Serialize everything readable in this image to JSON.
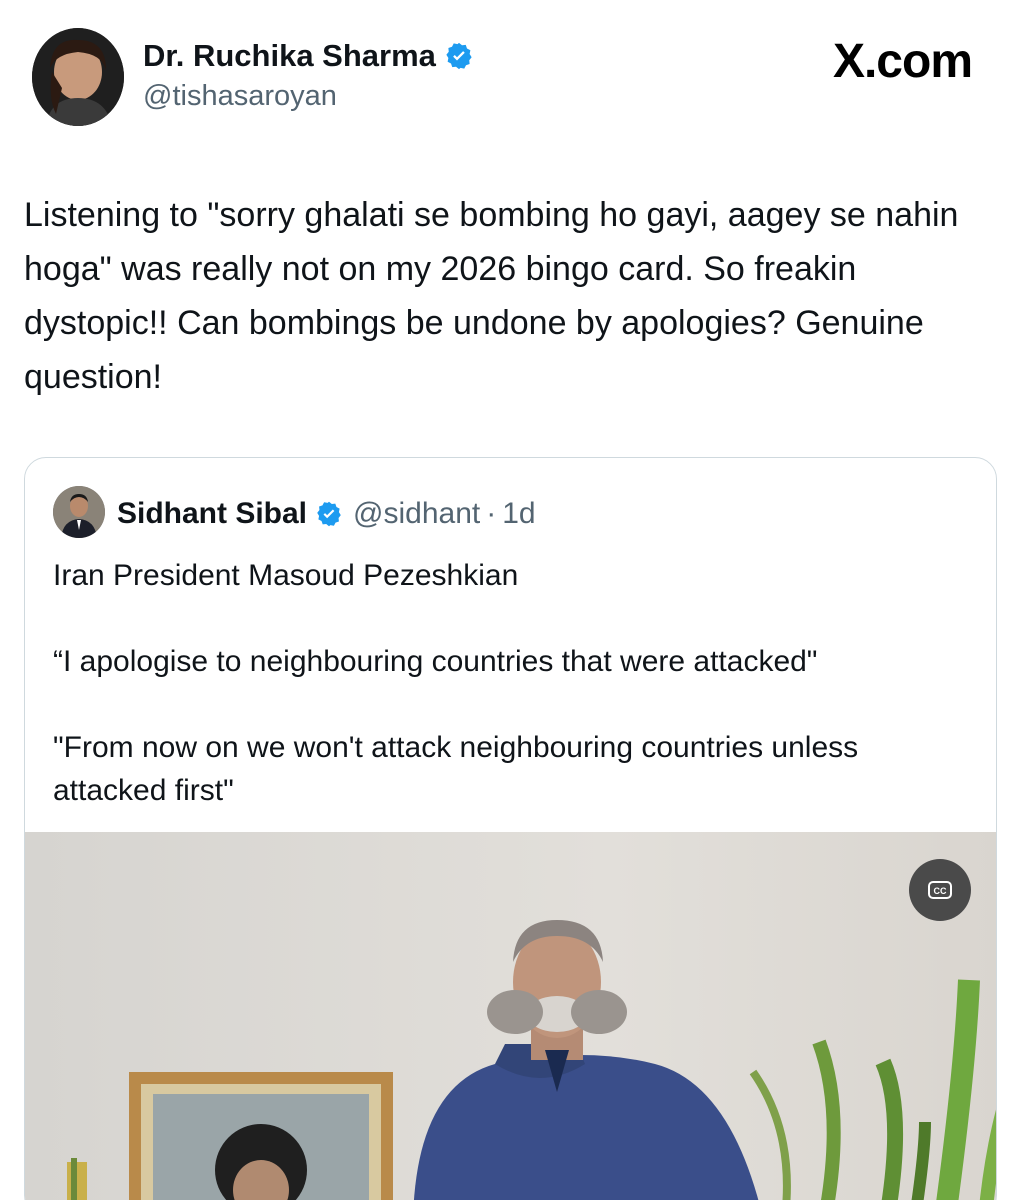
{
  "post": {
    "author_name": "Dr. Ruchika Sharma",
    "author_handle": "@tishasaroyan",
    "brand": "X.com",
    "text": "Listening to \"sorry ghalati se bombing ho gayi, aagey se nahin hoga\" was really not on my 2026 bingo card. So freakin dystopic!! Can bombings be undone by apologies? Genuine question!"
  },
  "quote": {
    "author_name": "Sidhant Sibal",
    "author_handle": "@sidhant",
    "separator": "·",
    "time": "1d",
    "paragraphs": [
      "Iran President Masoud Pezeshkian",
      "“I apologise to neighbouring countries that were attacked\"",
      "\"From now on we won't attack neighbouring countries unless attacked first\""
    ],
    "media": {
      "cc_icon": "closed-captions-icon"
    }
  },
  "icons": {
    "verified": "verified-badge-icon"
  },
  "colors": {
    "verified_blue": "#1d9bf0",
    "secondary_text": "#536471",
    "border": "#cfd9de"
  }
}
